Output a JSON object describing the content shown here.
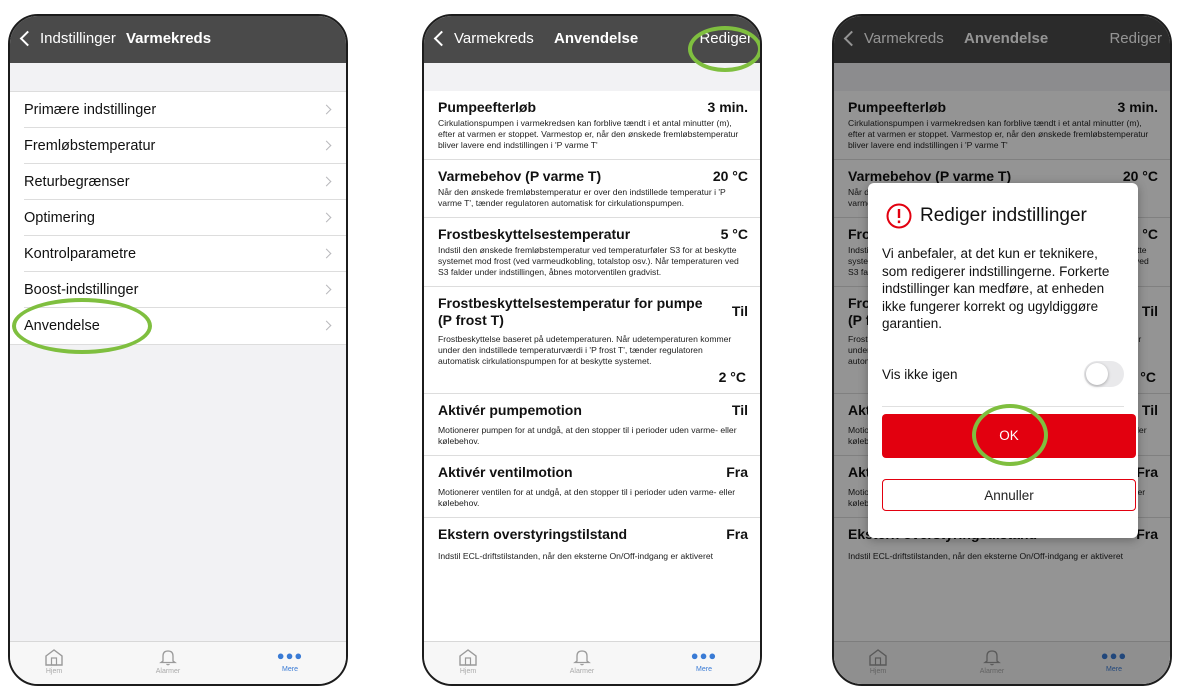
{
  "screen1": {
    "back_label": "Indstillinger",
    "title": "Varmekreds",
    "items": [
      {
        "label": "Primære indstillinger"
      },
      {
        "label": "Fremløbstemperatur"
      },
      {
        "label": "Returbegrænser"
      },
      {
        "label": "Optimering"
      },
      {
        "label": "Kontrolparametre"
      },
      {
        "label": "Boost-indstillinger"
      },
      {
        "label": "Anvendelse"
      }
    ]
  },
  "screen2": {
    "back_label": "Varmekreds",
    "title": "Anvendelse",
    "action_label": "Rediger",
    "settings": [
      {
        "title": "Pumpeefterløb",
        "value": "3 min.",
        "desc": "Cirkulationspumpen i varmekredsen kan forblive tændt i et antal minutter (m), efter at varmen er stoppet. Varmestop er, når den ønskede fremløbstemperatur bliver lavere end indstillingen i 'P varme T'"
      },
      {
        "title": "Varmebehov (P varme T)",
        "value": "20 °C",
        "desc": "Når den ønskede fremløbstemperatur er over den indstillede temperatur i 'P varme T', tænder regulatoren automatisk for cirkulationspumpen."
      },
      {
        "title": "Frostbeskyttelsestemperatur",
        "value": "5 °C",
        "desc": "Indstil den ønskede fremløbstemperatur ved temperaturføler S3 for at beskytte systemet mod frost (ved varmeudkobling, totalstop osv.). Når temperaturen ved S3 falder under indstillingen, åbnes motorventilen gradvist."
      },
      {
        "title": "Frostbeskyttelsestemperatur for pumpe (P frost T)",
        "value": "Til",
        "desc": "Frostbeskyttelse baseret på udetemperaturen. Når udetemperaturen kommer under den indstillede temperaturværdi i 'P frost T', tænder regulatoren automatisk cirkulationspumpen for at beskytte systemet.",
        "value2": "2 °C"
      },
      {
        "title": "Aktivér pumpemotion",
        "value": "Til",
        "desc": "Motionerer pumpen for at undgå, at den stopper til i perioder uden varme- eller kølebehov."
      },
      {
        "title": "Aktivér ventilmotion",
        "value": "Fra",
        "desc": "Motionerer ventilen for at undgå, at den stopper til i perioder uden varme- eller kølebehov."
      },
      {
        "title": "Ekstern overstyringstilstand",
        "value": "Fra",
        "desc": "Indstil ECL-driftstilstanden, når den eksterne On/Off-indgang er aktiveret"
      }
    ]
  },
  "dialog": {
    "title": "Rediger indstillinger",
    "body": "Vi anbefaler, at det kun er teknikere, som redigerer indstillingerne. Forkerte indstillinger kan medføre, at enheden ikke fungerer korrekt og ugyldiggøre garantien.",
    "toggle_label": "Vis ikke igen",
    "toggle_on": false,
    "ok_label": "OK",
    "cancel_label": "Annuller"
  },
  "tabs": [
    {
      "label": "Hjem",
      "icon": "home-icon"
    },
    {
      "label": "Alarmer",
      "icon": "bell-icon"
    },
    {
      "label": "Mere",
      "icon": "more-dots-icon"
    }
  ],
  "colors": {
    "navbar": "#4a4a4a",
    "accent_red": "#e2000f",
    "highlight_ring": "#7fbf3f",
    "tab_active": "#3a7bd5"
  }
}
